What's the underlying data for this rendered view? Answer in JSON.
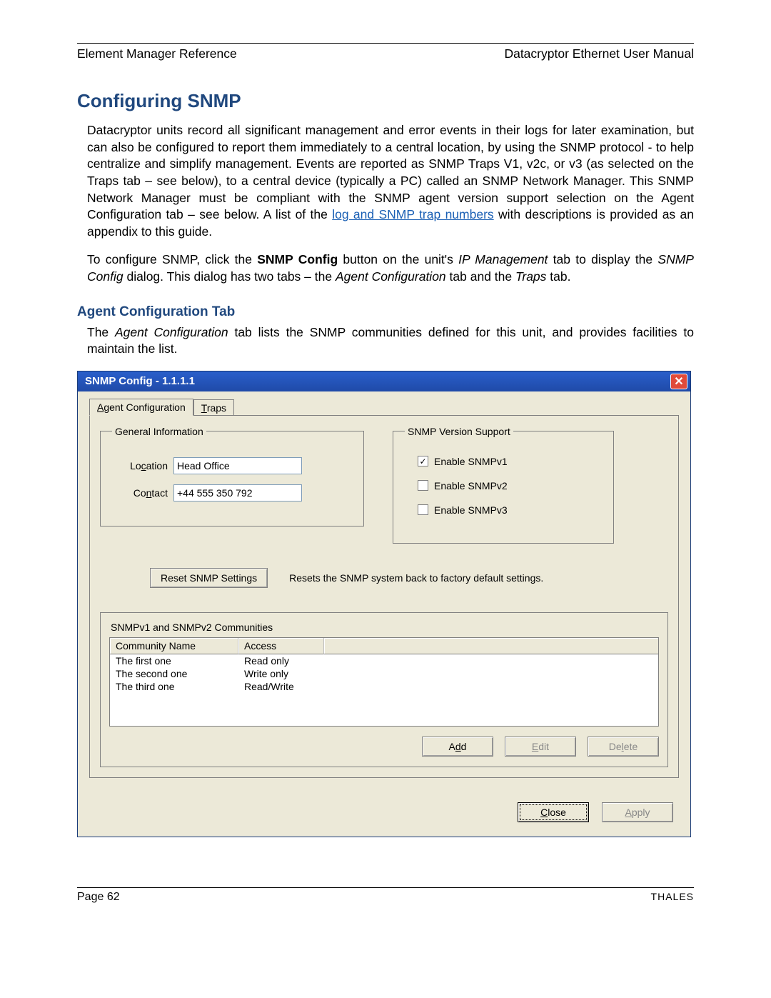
{
  "header": {
    "left": "Element Manager Reference",
    "right": "Datacryptor Ethernet User Manual"
  },
  "title": "Configuring SNMP",
  "para1_a": "Datacryptor units record all significant management and error events in their logs for later examination, but can also be configured to report them immediately to a central location, by using the SNMP protocol - to help centralize and simplify management.  Events are reported as SNMP Traps V1, v2c, or v3 (as selected on the Traps tab – see below), to a central device (typically a PC) called an SNMP Network Manager. This SNMP Network Manager must be compliant with the SNMP agent version support selection on the Agent Configuration tab – see below. A list of the ",
  "para1_link": "log and SNMP trap numbers",
  "para1_b": " with descriptions is provided as an appendix to this guide.",
  "para2_a": "To configure SNMP, click the ",
  "para2_bold": "SNMP Config",
  "para2_b": " button on the unit's ",
  "para2_ital1": "IP Management",
  "para2_c": " tab to display the ",
  "para2_ital2": "SNMP Config",
  "para2_d": " dialog. This dialog has two tabs – the ",
  "para2_ital3": "Agent Configuration",
  "para2_e": " tab and the ",
  "para2_ital4": "Traps",
  "para2_f": " tab.",
  "subheading": "Agent Configuration Tab",
  "para3_a": "The ",
  "para3_ital": "Agent Configuration",
  "para3_b": " tab lists the SNMP communities defined for this unit, and provides facilities to maintain the list.",
  "dialog": {
    "title": "SNMP Config - 1.1.1.1",
    "tabs": {
      "agent_u": "A",
      "agent_rest": "gent Configuration",
      "traps_u": "T",
      "traps_rest": "raps"
    },
    "general": {
      "legend": "General Information",
      "location_u": "c",
      "location_pre": "Lo",
      "location_post": "ation",
      "location_val": "Head Office",
      "contact_u": "n",
      "contact_pre": "Co",
      "contact_post": "tact",
      "contact_val": "+44 555 350 792"
    },
    "version": {
      "legend": "SNMP Version Support",
      "v1": "Enable SNMPv1",
      "v2": "Enable SNMPv2",
      "v3": "Enable SNMPv3"
    },
    "reset": {
      "btn": "Reset SNMP Settings",
      "text": "Resets the SNMP system back to factory default settings."
    },
    "comm": {
      "legend": "SNMPv1 and SNMPv2 Communities",
      "col1": "Community Name",
      "col2": "Access",
      "rows": [
        {
          "name": "The first one",
          "access": "Read only"
        },
        {
          "name": "The second one",
          "access": "Write only"
        },
        {
          "name": "The third one",
          "access": "Read/Write"
        }
      ],
      "add_u": "d",
      "add_pre": "A",
      "add_post": "d",
      "edit_u": "E",
      "edit_rest": "dit",
      "delete_pre": "De",
      "delete_u": "l",
      "delete_post": "ete"
    },
    "footer": {
      "close_u": "C",
      "close_rest": "lose",
      "apply_u": "A",
      "apply_rest": "pply"
    }
  },
  "footer": {
    "left": "Page 62",
    "right": "THALES"
  }
}
